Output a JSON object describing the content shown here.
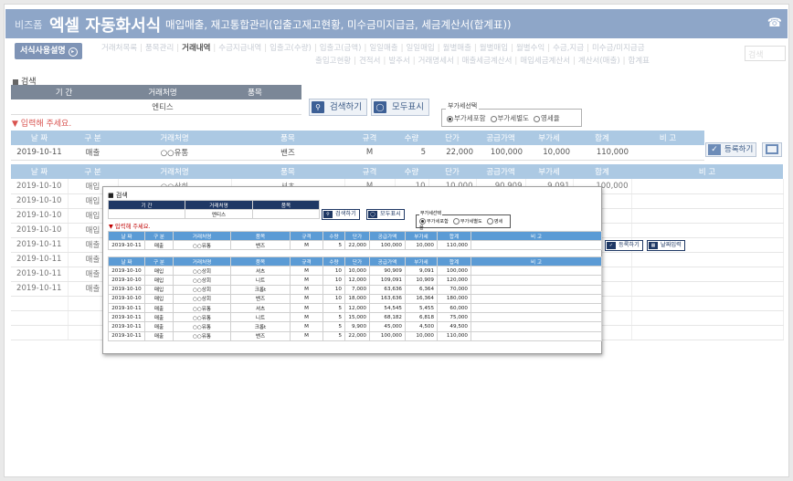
{
  "header": {
    "brand": "비즈폼",
    "title": "엑셀 자동화서식",
    "subtitle": "매입매출, 재고통합관리(입출고재고현황, 미수금미지급금, 세금계산서(합계표))",
    "phone_icon": "phone-icon"
  },
  "help_button": {
    "label": "서식사용설명"
  },
  "nav_row1": [
    "거래처목록",
    "품목관리",
    "거래내역",
    "수금지급내역",
    "입출고(수량)",
    "입출고(금액)",
    "일일매출",
    "일일매입",
    "월별매출",
    "월별매입",
    "월별수익",
    "수금,지급",
    "미수금/미지급금"
  ],
  "nav_row1_active": 2,
  "nav_row2": [
    "출입고현황",
    "견적서",
    "발주서",
    "거래명세서",
    "매출세금계산서",
    "매입세금계산서",
    "계산서(매출)",
    "합계표"
  ],
  "search_placeholder": "검색",
  "search_section": {
    "title": "검색",
    "headers": [
      "기 간",
      "거래처명",
      "품목"
    ],
    "values": [
      "",
      "엔티스",
      ""
    ]
  },
  "buttons": {
    "search": "검색하기",
    "show_all": "모두표시",
    "register": "등록하기",
    "date": "날짜입력"
  },
  "vat": {
    "label": "부가세선택",
    "options": [
      "부가세포함",
      "부가세별도",
      "영세율"
    ],
    "selected": 0
  },
  "input_warning": "입력해 주세요.",
  "columns": [
    "날 짜",
    "구 분",
    "거래처명",
    "품목",
    "규격",
    "수량",
    "단가",
    "공급가액",
    "부가세",
    "합계",
    "비 고"
  ],
  "entry_row": [
    "2019-10-11",
    "매출",
    "○○유통",
    "밴즈",
    "M",
    "5",
    "22,000",
    "100,000",
    "10,000",
    "110,000",
    ""
  ],
  "bg_rows": [
    [
      "2019-10-10",
      "매입"
    ],
    [
      "2019-10-10",
      "매입"
    ],
    [
      "2019-10-10",
      "매입"
    ],
    [
      "2019-10-10",
      "매입"
    ],
    [
      "2019-10-11",
      "매출"
    ],
    [
      "2019-10-11",
      "매출"
    ],
    [
      "2019-10-11",
      "매출"
    ],
    [
      "2019-10-11",
      "매출"
    ]
  ],
  "bg_row1_partial": [
    "",
    "",
    "○○상회",
    "셔츠",
    "M",
    "10",
    "10,000",
    "90,909",
    "9,091",
    "100,000",
    ""
  ],
  "overlay_rows": [
    [
      "2019-10-10",
      "매입",
      "○○상회",
      "셔츠",
      "M",
      "10",
      "10,000",
      "90,909",
      "9,091",
      "100,000",
      ""
    ],
    [
      "2019-10-10",
      "매입",
      "○○상회",
      "니트",
      "M",
      "10",
      "12,000",
      "109,091",
      "10,909",
      "120,000",
      ""
    ],
    [
      "2019-10-10",
      "매입",
      "○○상회",
      "크롭t",
      "M",
      "10",
      "7,000",
      "63,636",
      "6,364",
      "70,000",
      ""
    ],
    [
      "2019-10-10",
      "매입",
      "○○상회",
      "밴즈",
      "M",
      "10",
      "18,000",
      "163,636",
      "16,364",
      "180,000",
      ""
    ],
    [
      "2019-10-11",
      "매출",
      "○○유통",
      "셔츠",
      "M",
      "5",
      "12,000",
      "54,545",
      "5,455",
      "60,000",
      ""
    ],
    [
      "2019-10-11",
      "매출",
      "○○유통",
      "니트",
      "M",
      "5",
      "15,000",
      "68,182",
      "6,818",
      "75,000",
      ""
    ],
    [
      "2019-10-11",
      "매출",
      "○○유통",
      "크롭t",
      "M",
      "5",
      "9,900",
      "45,000",
      "4,500",
      "49,500",
      ""
    ],
    [
      "2019-10-11",
      "매출",
      "○○유통",
      "밴즈",
      "M",
      "5",
      "22,000",
      "100,000",
      "10,000",
      "110,000",
      ""
    ]
  ]
}
